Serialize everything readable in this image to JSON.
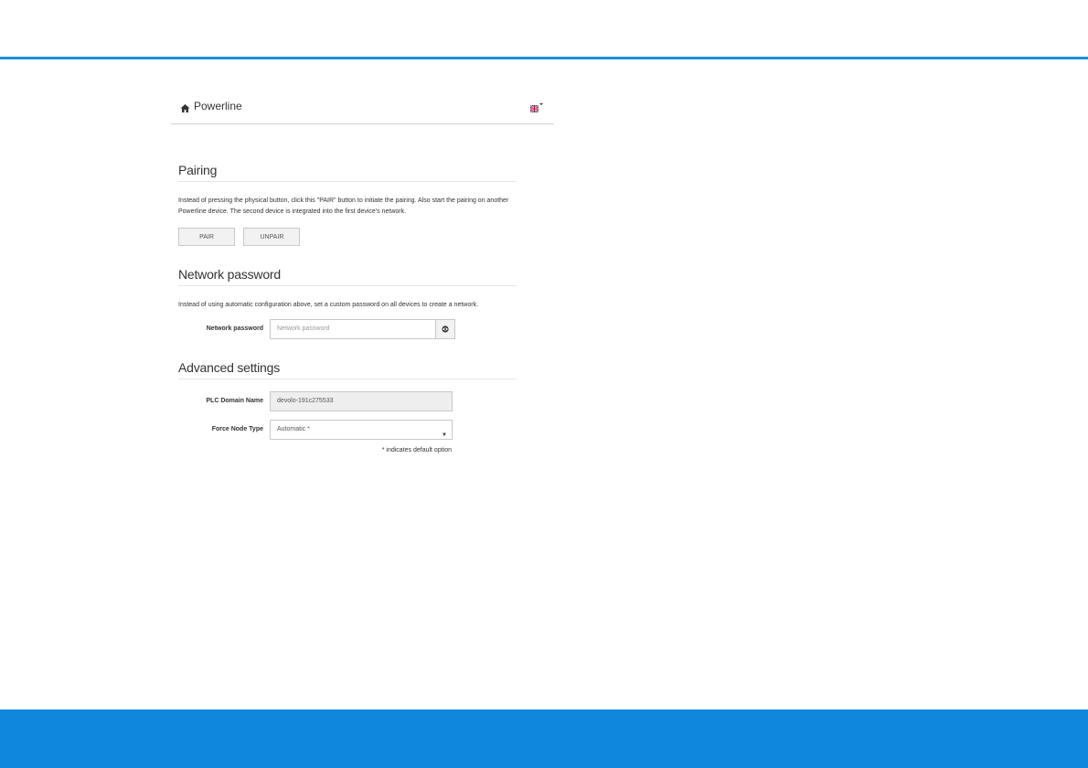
{
  "navbar": {
    "brand_label": "Powerline",
    "home_icon": "home-icon",
    "language_icon": "uk-flag-icon"
  },
  "pairing": {
    "title": "Pairing",
    "description_line1": "Instead of pressing the physical button, click this \"PAIR\" button to initiate the pairing. Also start the pairing on another",
    "description_line2": "Powerline device. The second device is integrated into the first device's network.",
    "pair_label": "PAIR",
    "unpair_label": "UNPAIR"
  },
  "network_password": {
    "title": "Network password",
    "description": "Instead of using automatic configuration above, set a custom password on all devices to create a network.",
    "field_label": "Network password",
    "field_placeholder": "Network password",
    "field_value": "",
    "reveal_icon": "eye-icon"
  },
  "advanced": {
    "title": "Advanced settings",
    "domain_label": "PLC Domain Name",
    "domain_value": "devolo-191c275533",
    "node_type_label": "Force Node Type",
    "node_type_selected": "Automatic *",
    "default_hint": "* indicates default option"
  },
  "colors": {
    "accent_blue": "#0f87dd",
    "rule_blue": "#1d8fd9"
  }
}
